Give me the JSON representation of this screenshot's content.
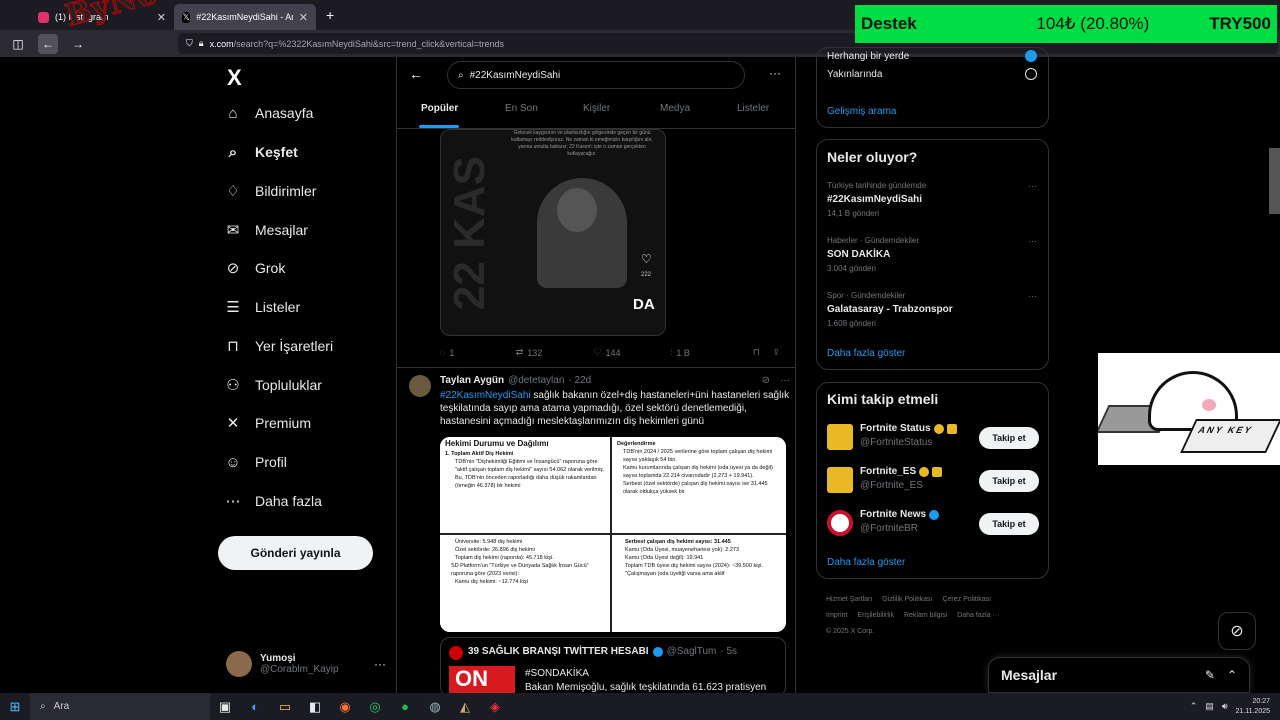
{
  "browser": {
    "tabs": [
      {
        "label": "(1) Instagram",
        "favicon_color": "#e1306c"
      },
      {
        "label": "#22KasımNeydiSahi - Arama / X",
        "favicon_color": "#000000"
      }
    ],
    "url_host": "x.com",
    "url_path": "/search?q=%2322KasımNeydiSahi&src=trend_click&vertical=trends"
  },
  "overlay": {
    "watermark": "ByNoGame",
    "support_label": "Destek",
    "support_amount": "104₺ (20.80%)",
    "support_goal": "TRY500",
    "support_color": "#00dd44"
  },
  "left_nav": {
    "logo": "X",
    "items": [
      {
        "icon": "home-icon",
        "glyph": "⌂",
        "label": "Anasayfa"
      },
      {
        "icon": "search-icon",
        "glyph": "⌕",
        "label": "Keşfet"
      },
      {
        "icon": "bell-icon",
        "glyph": "♢",
        "label": "Bildirimler"
      },
      {
        "icon": "mail-icon",
        "glyph": "✉",
        "label": "Mesajlar"
      },
      {
        "icon": "grok-icon",
        "glyph": "⊘",
        "label": "Grok"
      },
      {
        "icon": "list-icon",
        "glyph": "☰",
        "label": "Listeler"
      },
      {
        "icon": "bookmark-icon",
        "glyph": "⊓",
        "label": "Yer İşaretleri"
      },
      {
        "icon": "communities-icon",
        "glyph": "⚇",
        "label": "Topluluklar"
      },
      {
        "icon": "x-premium-icon",
        "glyph": "✕",
        "label": "Premium"
      },
      {
        "icon": "profile-icon",
        "glyph": "☺",
        "label": "Profil"
      },
      {
        "icon": "more-icon",
        "glyph": "⋯",
        "label": "Daha fazla"
      }
    ],
    "post_button": "Gönderi yayınla",
    "profile_name": "Yumoşi",
    "profile_handle": "@Corablm_Kayip"
  },
  "search": {
    "query": "#22KasımNeydiSahi",
    "tabs": [
      "Popüler",
      "En Son",
      "Kişiler",
      "Medya",
      "Listeler"
    ]
  },
  "tweet1": {
    "caption": "Gelecek kaygısının ve planlsızlığın gölgesinde geçen bir günü kutlamayı reddediyoruz. Ne zaman ki emeğimizin karşılığını alır, yarına umutla bakarız; 22 Kasım'ı işte o zaman gerçekten kutlayacağız.",
    "vertical_text": "22 KAS",
    "like_count_overlay": "222",
    "replies": "1",
    "retweets": "132",
    "likes": "144",
    "views": "1 B"
  },
  "tweet2": {
    "name": "Taylan Aygün",
    "handle": "@detetaylan",
    "time": "· 22d",
    "hashtag": "#22KasımNeydiSahi",
    "text": " sağlık bakanın özel+diş hastaneleri+üni hastaneleri sağlık teşkilatında sayıp ama atama yapmadığı, özel sektörü denetlemediği, hastanesini açmadığı meslektaşlarımızın diş hekimleri günü",
    "image": {
      "title": "Hekimi Durumu ve Dağılımı",
      "q1": [
        "1. Toplam Aktif Diş Hekimi",
        "TDB'nin \"Dişhekimliği Eğitimi ve İnsangücü\" raporuna göre \"aktif çalışan toplam diş hekimi\" sayısı 54.062 olarak verilmiş.",
        "Bu, TDB'nin önceden raporladığı daha düşük rakamlardan (örneğin 46.378) bir hekimi"
      ],
      "q2": [
        "Değerlendirme",
        "TDB'nin 2024 / 2025 verilerine göre toplam çalışan diş hekimi sayısı yaklaşık 54 bin.",
        "Kamu kurumlarında çalışan diş hekimi (oda üyesi ya da değil) sayısı toplamda 22.214 civarındadır (2.273 + 19.941).",
        "Serbest (özel sektörde) çalışan diş hekimi sayısı ise 31.445 olarak oldukça yüksek bir"
      ],
      "q3": [
        "Üniversite: 5.948 diş hekimi",
        "Özel sektörde: 26.896 diş hekimi",
        "Toplam diş hekimi (raporda): 45.718 kişi.",
        "SD Platform'un \"Türkiye ve Dünyada Sağlık İnsan Gücü\" raporuna göre (2023 verisi):",
        "Kamu diş hekimi: ~12.774 kişi"
      ],
      "q4": [
        "Serbest çalışan diş hekimi sayısı: 31.445",
        "Kamu (Oda Üyesi, muayenehanesi yok): 2.273",
        "Kamu (Oda Üyesi değil): 19.941",
        "Toplam TDB üyesi diş hekimi sayısı (2024): ~39.500 kişi.",
        "\"Çalışmayan (oda üyeliği varsa ama aktif"
      ]
    },
    "quote": {
      "name": "39 SAĞLIK BRANŞI TWİTTER HESABI",
      "handle": "@SaglTum",
      "time": "· 5s",
      "image_text": "ON",
      "tag": "#SONDAKİKA",
      "text": "Bakan Memişoğlu, sağlık teşkilatında 61.623 pratisyen"
    }
  },
  "right": {
    "location_options": [
      "Herhangi bir yerde",
      "Yakınlarında"
    ],
    "advanced_search": "Gelişmiş arama",
    "trends_title": "Neler oluyor?",
    "trends": [
      {
        "meta": "Türkiye tarihinde gündemde",
        "name": "#22KasımNeydiSahi",
        "count": "14,1 B gönderi"
      },
      {
        "meta": "Haberler · Gündemdekiler",
        "name": "SON DAKİKA",
        "count": "3.004 gönderi"
      },
      {
        "meta": "Spor · Gündemdekiler",
        "name": "Galatasaray - Trabzonspor",
        "count": "1.608 gönderi"
      }
    ],
    "show_more": "Daha fazla göster",
    "follow_title": "Kimi takip etmeli",
    "follows": [
      {
        "name": "Fortnite Status",
        "handle": "@FortniteStatus",
        "color": "#e8b923",
        "button": "Takip et"
      },
      {
        "name": "Fortnite_ES",
        "handle": "@Fortnite_ES",
        "color": "#e8b923",
        "button": "Takip et"
      },
      {
        "name": "Fortnite News",
        "handle": "@FortniteBR",
        "color": "#ffffff",
        "button": "Takip et"
      }
    ],
    "show_more2": "Daha fazla göster",
    "footer": [
      "Hizmet Şartları",
      "Gizlilik Politikası",
      "Çerez Politikası",
      "Imprint",
      "Erişilebilirlik",
      "Reklam bilgisi",
      "Daha fazla ···",
      "© 2025 X Corp."
    ]
  },
  "messages": {
    "title": "Mesajlar"
  },
  "sticker": {
    "keys": "ANY KEY"
  },
  "taskbar": {
    "search_placeholder": "Ara",
    "time": "20:27",
    "date": "21.11.2025"
  }
}
